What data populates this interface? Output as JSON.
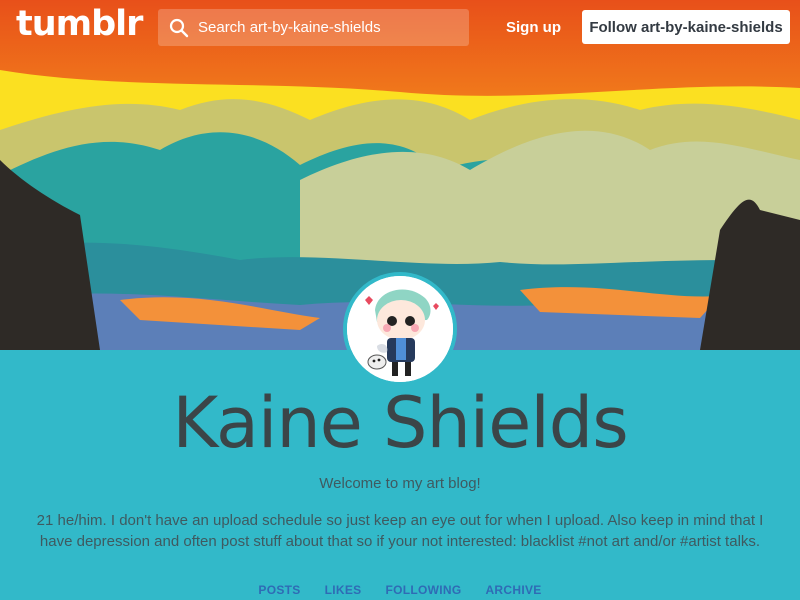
{
  "topbar": {
    "logo": "tumblr",
    "search_placeholder": "Search art-by-kaine-shields",
    "signup_label": "Sign up",
    "follow_label": "Follow art-by-kaine-shields"
  },
  "blog": {
    "title": "Kaine Shields",
    "subtitle": "Welcome to my art blog!",
    "description": "21 he/him. I don't have an upload schedule so just keep an eye out for when I upload. Also keep in mind that I have depression and often post stuff about that so if your not interested: blacklist #not art and/or #artist talks."
  },
  "nav": [
    "POSTS",
    "LIKES",
    "FOLLOWING",
    "ARCHIVE"
  ],
  "colors": {
    "background": "#32b9c9",
    "nav_link": "#2f6bb5",
    "title": "#3b4548"
  },
  "icons": {
    "search": "search-icon"
  }
}
